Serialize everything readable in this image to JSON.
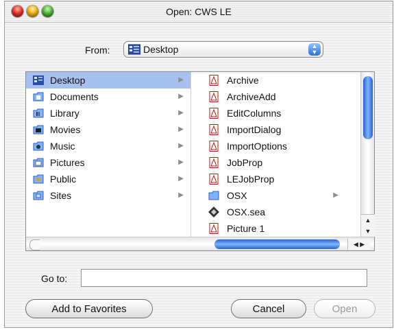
{
  "window": {
    "title": "Open: CWS LE"
  },
  "from": {
    "label": "From:",
    "selected": "Desktop"
  },
  "locations": [
    {
      "name": "Desktop",
      "icon": "desktop-icon",
      "selected": true
    },
    {
      "name": "Documents",
      "icon": "documents-folder-icon",
      "selected": false
    },
    {
      "name": "Library",
      "icon": "library-folder-icon",
      "selected": false
    },
    {
      "name": "Movies",
      "icon": "movies-folder-icon",
      "selected": false
    },
    {
      "name": "Music",
      "icon": "music-folder-icon",
      "selected": false
    },
    {
      "name": "Pictures",
      "icon": "pictures-folder-icon",
      "selected": false
    },
    {
      "name": "Public",
      "icon": "public-folder-icon",
      "selected": false
    },
    {
      "name": "Sites",
      "icon": "sites-folder-icon",
      "selected": false
    }
  ],
  "files": [
    {
      "name": "Archive",
      "icon": "pdf-icon"
    },
    {
      "name": "ArchiveAdd",
      "icon": "pdf-icon"
    },
    {
      "name": "EditColumns",
      "icon": "pdf-icon"
    },
    {
      "name": "ImportDialog",
      "icon": "pdf-icon"
    },
    {
      "name": "ImportOptions",
      "icon": "pdf-icon"
    },
    {
      "name": "JobProp",
      "icon": "pdf-icon"
    },
    {
      "name": "LEJobProp",
      "icon": "pdf-icon"
    },
    {
      "name": "OSX",
      "icon": "folder-icon",
      "folder": true
    },
    {
      "name": "OSX.sea",
      "icon": "archive-icon"
    },
    {
      "name": "Picture 1",
      "icon": "pdf-icon"
    }
  ],
  "goto": {
    "label": "Go to:",
    "value": ""
  },
  "buttons": {
    "favorites": "Add to Favorites",
    "cancel": "Cancel",
    "open": "Open"
  },
  "colors": {
    "selection": "#a6c1ef",
    "scroll_accent": "#2a5fd0"
  }
}
